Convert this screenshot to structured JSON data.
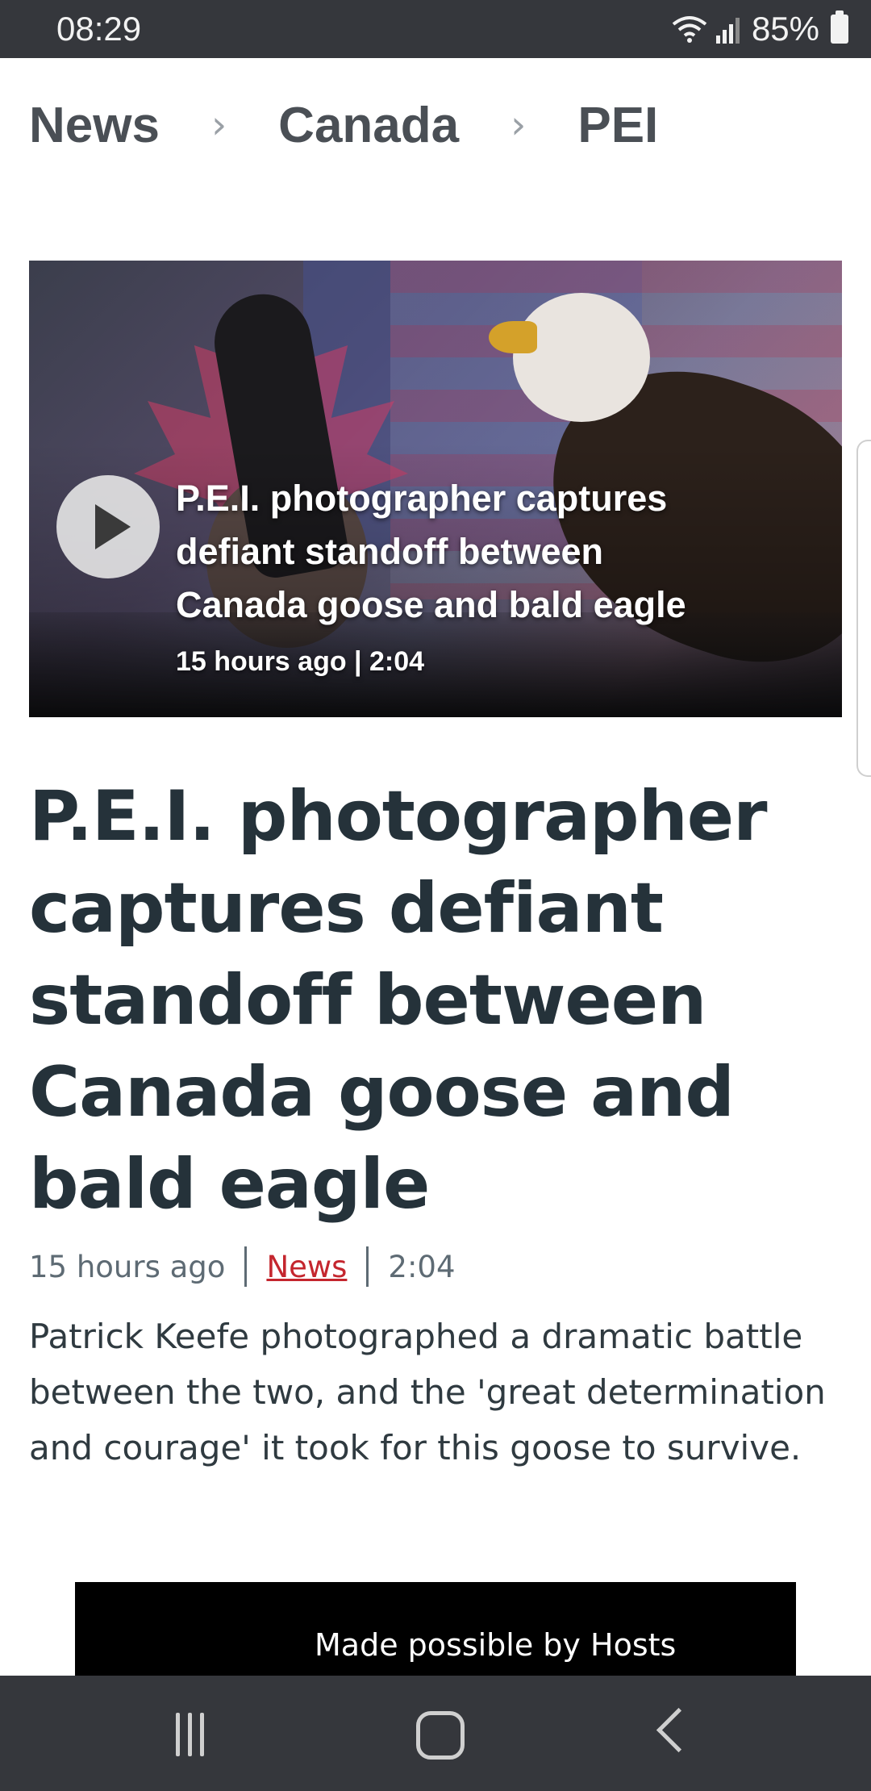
{
  "status_bar": {
    "time": "08:29",
    "battery": "85%"
  },
  "breadcrumb": {
    "items": [
      "News",
      "Canada",
      "PEI"
    ]
  },
  "video": {
    "title": "P.E.I. photographer captures defiant standoff between Canada goose and bald eagle",
    "meta": "15 hours ago | 2:04"
  },
  "article": {
    "headline": "P.E.I. photographer captures defiant standoff between Canada goose and bald eagle",
    "time_ago": "15 hours ago",
    "category": "News",
    "duration": "2:04",
    "summary": "Patrick Keefe photographed a dramatic battle between the two, and the 'great determination and courage' it took for this goose to survive."
  },
  "ad": {
    "text": "Made possible by Hosts"
  },
  "colors": {
    "status_bar_bg": "#35373c",
    "headline": "#25323a",
    "category_link": "#c4262e"
  }
}
